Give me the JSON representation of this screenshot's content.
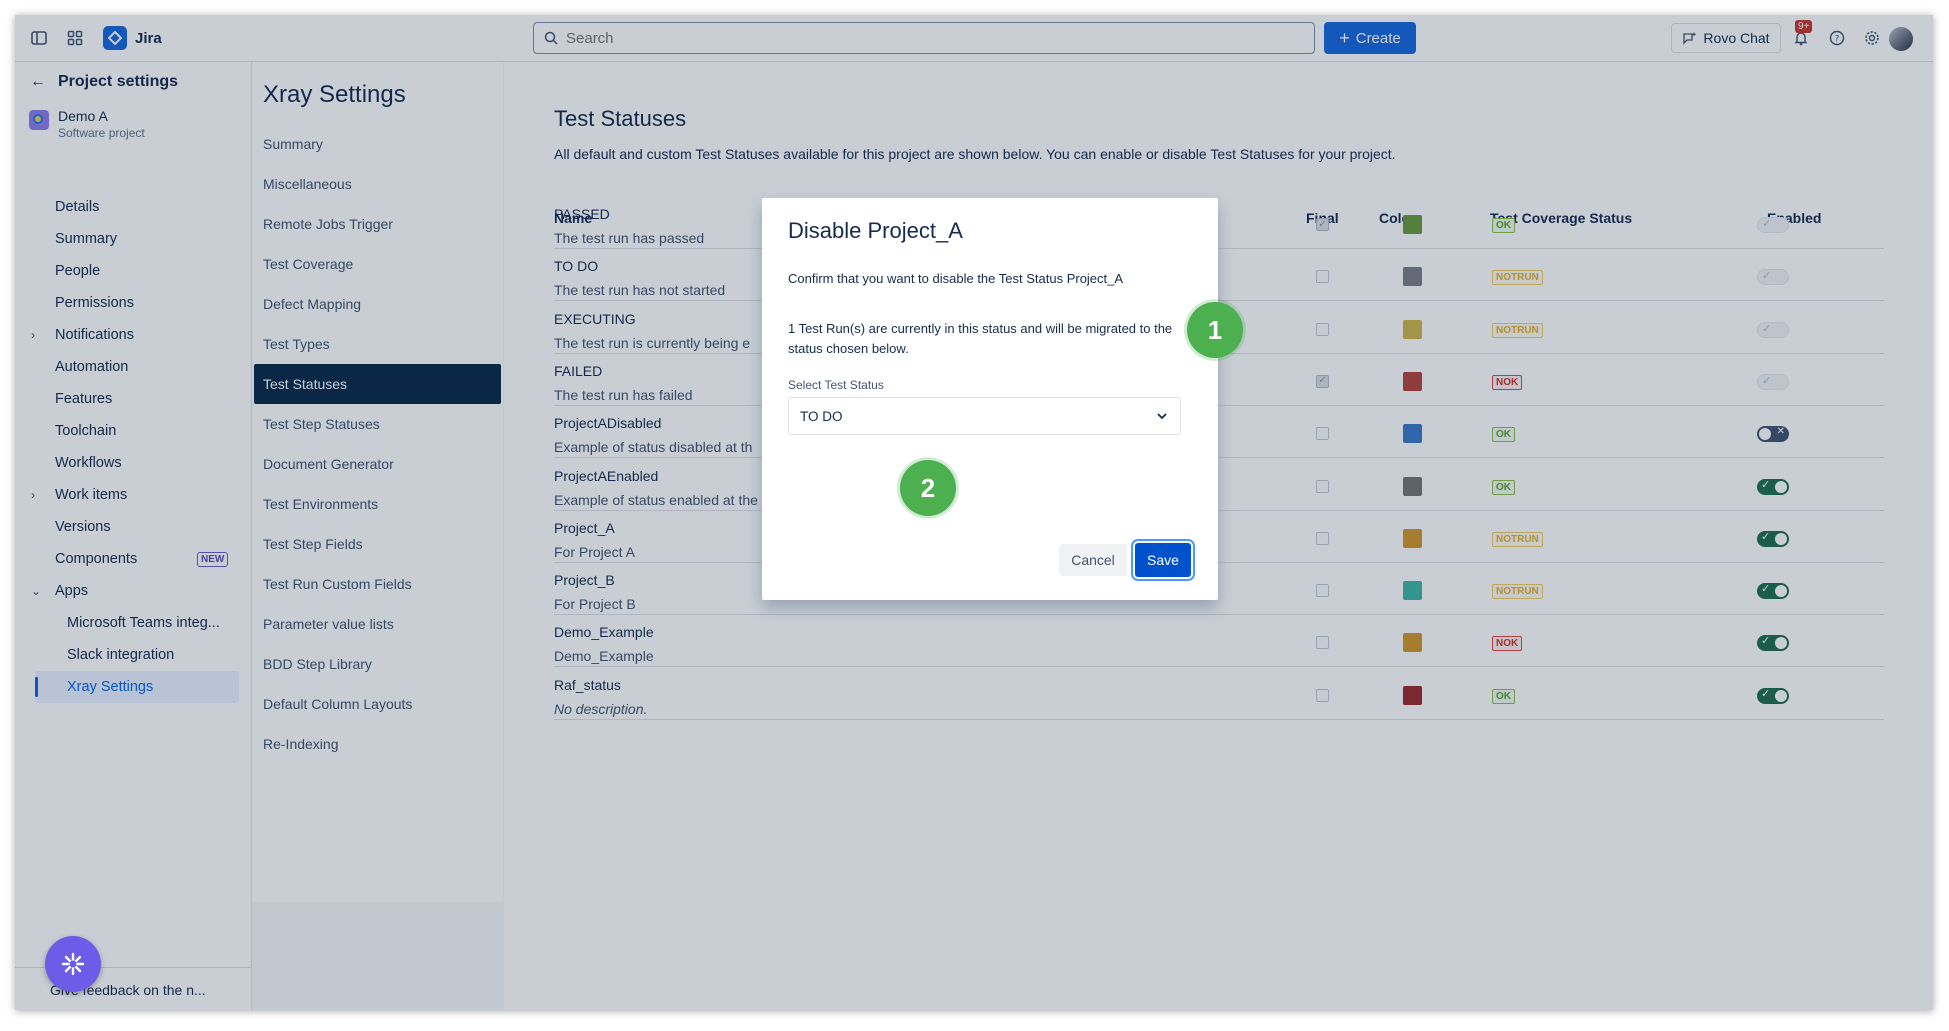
{
  "topbar": {
    "app_name": "Jira",
    "search_placeholder": "Search",
    "create_label": "Create",
    "rovo_label": "Rovo Chat",
    "notifications_badge": "9+"
  },
  "sidebar": {
    "back_label": "Project settings",
    "project_name": "Demo A",
    "project_type": "Software project",
    "items": [
      {
        "label": "Details"
      },
      {
        "label": "Summary"
      },
      {
        "label": "People"
      },
      {
        "label": "Permissions"
      },
      {
        "label": "Notifications"
      },
      {
        "label": "Automation"
      },
      {
        "label": "Features"
      },
      {
        "label": "Toolchain"
      },
      {
        "label": "Workflows"
      },
      {
        "label": "Work items"
      },
      {
        "label": "Versions"
      },
      {
        "label": "Components",
        "badge": "NEW"
      },
      {
        "label": "Apps"
      },
      {
        "label": "Microsoft Teams integ..."
      },
      {
        "label": "Slack integration"
      },
      {
        "label": "Xray Settings"
      }
    ],
    "feedback_label": "Give feedback on the n..."
  },
  "xray": {
    "title": "Xray Settings",
    "items": [
      "Summary",
      "Miscellaneous",
      "Remote Jobs Trigger",
      "Test Coverage",
      "Defect Mapping",
      "Test Types",
      "Test Statuses",
      "Test Step Statuses",
      "Document Generator",
      "Test Environments",
      "Test Step Fields",
      "Test Run Custom Fields",
      "Parameter value lists",
      "BDD Step Library",
      "Default Column Layouts",
      "Re-Indexing"
    ]
  },
  "main": {
    "title": "Test Statuses",
    "description": "All default and custom Test Statuses available for this project are shown below. You can enable or disable Test Statuses for your project.",
    "columns": {
      "name": "Name",
      "final": "Final",
      "color": "Color",
      "coverage": "Test Coverage Status",
      "enabled": "Enabled"
    },
    "rows": [
      {
        "name": "PASSED",
        "desc": "The test run has passed",
        "final": true,
        "color": "#6a9a3b",
        "coverage": "OK",
        "enabled": "default"
      },
      {
        "name": "TO DO",
        "desc": "The test run has not started",
        "final": false,
        "color": "#7a7f86",
        "coverage": "NOTRUN",
        "enabled": "default"
      },
      {
        "name": "EXECUTING",
        "desc": "The test run is currently being e",
        "final": false,
        "color": "#cdb74a",
        "coverage": "NOTRUN",
        "enabled": "default"
      },
      {
        "name": "FAILED",
        "desc": "The test run has failed",
        "final": true,
        "color": "#b5443b",
        "coverage": "NOK",
        "enabled": "default"
      },
      {
        "name": "ProjectADisabled",
        "desc": "Example of status disabled at th",
        "final": false,
        "color": "#3a7bc8",
        "coverage": "OK",
        "enabled": "off"
      },
      {
        "name": "ProjectAEnabled",
        "desc": "Example of status enabled at the project level",
        "final": false,
        "color": "#777777",
        "coverage": "OK",
        "enabled": "on"
      },
      {
        "name": "Project_A",
        "desc": "For Project A",
        "final": false,
        "color": "#d3962a",
        "coverage": "NOTRUN",
        "enabled": "on"
      },
      {
        "name": "Project_B",
        "desc": "For Project B",
        "final": false,
        "color": "#3fb6a0",
        "coverage": "NOTRUN",
        "enabled": "on"
      },
      {
        "name": "Demo_Example",
        "desc": "Demo_Example",
        "final": false,
        "color": "#d3962a",
        "coverage": "NOK",
        "enabled": "on"
      },
      {
        "name": "Raf_status",
        "desc": "No description.",
        "final": false,
        "color": "#9b2c2c",
        "coverage": "OK",
        "enabled": "on"
      }
    ]
  },
  "modal": {
    "title": "Disable Project_A",
    "confirm_text": "Confirm that you want to disable the Test Status Project_A",
    "info_text": "1 Test Run(s) are currently in this status and will be migrated to the status chosen below.",
    "select_label": "Select Test Status",
    "selected_value": "TO DO",
    "cancel_label": "Cancel",
    "save_label": "Save"
  },
  "annotations": [
    "1",
    "2"
  ]
}
